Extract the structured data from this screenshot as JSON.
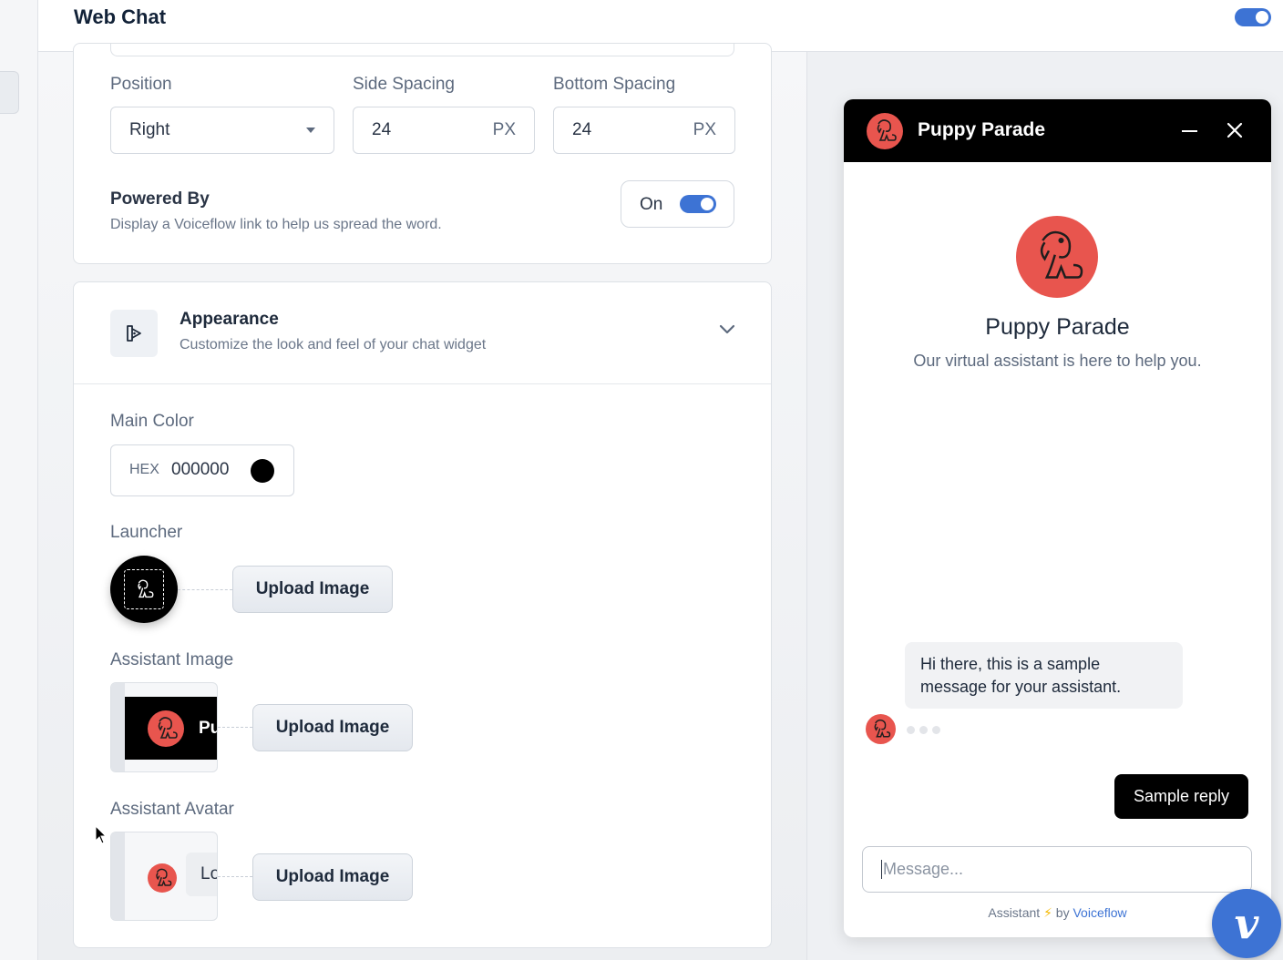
{
  "header": {
    "title": "Web Chat"
  },
  "placement": {
    "position_label": "Position",
    "position_value": "Right",
    "side_label": "Side Spacing",
    "side_value": "24",
    "side_unit": "PX",
    "bottom_label": "Bottom Spacing",
    "bottom_value": "24",
    "bottom_unit": "PX"
  },
  "powered": {
    "title": "Powered By",
    "description": "Display a Voiceflow link to help us spread the word.",
    "state": "On"
  },
  "appearance": {
    "title": "Appearance",
    "subtitle": "Customize the look and feel of your chat widget",
    "main_color_label": "Main Color",
    "hex_label": "HEX",
    "hex_value": "000000",
    "swatch_color": "#000000",
    "launcher_label": "Launcher",
    "assistant_image_label": "Assistant Image",
    "assistant_avatar_label": "Assistant Avatar",
    "upload_label": "Upload Image",
    "thumb_image_text": "Pu",
    "thumb_avatar_text": "Lo"
  },
  "preview": {
    "header_name": "Puppy Parade",
    "title": "Puppy Parade",
    "subtitle": "Our virtual assistant is here to help you.",
    "assistant_message": "Hi there, this is a sample message for your assistant.",
    "user_reply": "Sample reply",
    "input_placeholder": "Message...",
    "footer_prefix": "Assistant",
    "footer_by": "by",
    "footer_brand": "Voiceflow"
  },
  "launcher_button": {
    "glyph": "v"
  },
  "colors": {
    "accent": "#3d73d4",
    "avatar": "#e8554e",
    "main": "#000000"
  },
  "icons": [
    "appearance-icon",
    "chevron-down-icon",
    "close-icon",
    "minimize-icon",
    "puppy-avatar-icon",
    "mouse-cursor-icon"
  ]
}
